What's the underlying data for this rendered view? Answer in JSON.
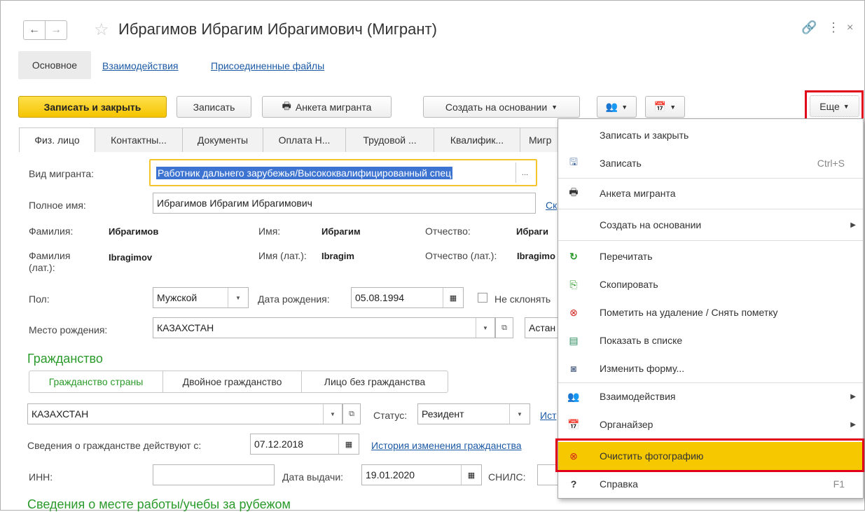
{
  "window": {
    "title": "Ибрагимов Ибрагим Ибрагимович (Мигрант)"
  },
  "nav_tabs": [
    "Основное",
    "Взаимодействия",
    "Присоединенные файлы"
  ],
  "toolbar": {
    "save_close": "Записать и закрыть",
    "save": "Записать",
    "anketa": "Анкета мигранта",
    "create_basis": "Создать на основании",
    "more": "Еще"
  },
  "tabs": [
    "Физ. лицо",
    "Контактны...",
    "Документы",
    "Оплата Н...",
    "Трудовой ...",
    "Квалифик...",
    "Мигр"
  ],
  "form": {
    "vid_label": "Вид мигранта:",
    "vid_value": "Работник дальнего зарубежья/Высококвалифицированный спец",
    "fullname_label": "Полное имя:",
    "fullname_value": "Ибрагимов Ибрагим Ибрагимович",
    "fullname_link": "Ск",
    "surname_label": "Фамилия:",
    "surname_value": "Ибрагимов",
    "name_label": "Имя:",
    "name_value": "Ибрагим",
    "patr_label": "Отчество:",
    "patr_value": "Ибраги",
    "surname_lat_label_1": "Фамилия",
    "surname_lat_label_2": "(лат.):",
    "surname_lat_value": "Ibragimov",
    "name_lat_label": "Имя (лат.):",
    "name_lat_value": "Ibragim",
    "patr_lat_label": "Отчество (лат.):",
    "patr_lat_value": "Ibragimo",
    "sex_label": "Пол:",
    "sex_value": "Мужской",
    "dob_label": "Дата рождения:",
    "dob_value": "05.08.1994",
    "no_decline_label": "Не склонять",
    "birthplace_label": "Место рождения:",
    "birthplace_value": "КАЗАХСТАН",
    "birthplace_city": "Астан"
  },
  "citizenship": {
    "header": "Гражданство",
    "segments": [
      "Гражданство страны",
      "Двойное гражданство",
      "Лицо без гражданства"
    ],
    "country": "КАЗАХСТАН",
    "status_label": "Статус:",
    "status_value": "Резидент",
    "history_link_short": "Ист",
    "since_label": "Сведения о гражданстве действуют с:",
    "since_value": "07.12.2018",
    "history_link": "История изменения гражданства"
  },
  "ids": {
    "inn_label": "ИНН:",
    "inn_value": "",
    "issue_label": "Дата выдачи:",
    "issue_value": "19.01.2020",
    "snils_label": "СНИЛС:"
  },
  "work_abroad_header": "Сведения о месте работы/учебы за рубежом",
  "menu": {
    "items": [
      {
        "label": "Записать и закрыть",
        "shortcut": "",
        "icon": ""
      },
      {
        "label": "Записать",
        "shortcut": "Ctrl+S",
        "icon": "save-icon"
      },
      {
        "label": "Анкета мигранта",
        "shortcut": "",
        "icon": "printer-icon"
      },
      {
        "label": "Создать на основании",
        "shortcut": "",
        "icon": ""
      },
      {
        "label": "Перечитать",
        "shortcut": "",
        "icon": "refresh-icon"
      },
      {
        "label": "Скопировать",
        "shortcut": "",
        "icon": "copy-icon"
      },
      {
        "label": "Пометить на удаление / Снять пометку",
        "shortcut": "",
        "icon": "delete-mark-icon"
      },
      {
        "label": "Показать в списке",
        "shortcut": "",
        "icon": "list-icon"
      },
      {
        "label": "Изменить форму...",
        "shortcut": "",
        "icon": "form-settings-icon"
      },
      {
        "label": "Взаимодействия",
        "shortcut": "",
        "icon": "interactions-icon"
      },
      {
        "label": "Органайзер",
        "shortcut": "",
        "icon": "organizer-icon"
      },
      {
        "label": "Очистить фотографию",
        "shortcut": "",
        "icon": "clear-photo-icon"
      },
      {
        "label": "Справка",
        "shortcut": "F1",
        "icon": "help-icon"
      }
    ]
  },
  "colors": {
    "accent_yellow": "#f6c800",
    "highlight_red": "#e0001a",
    "section_green": "#2a9a2a",
    "link_blue": "#1c5aa6"
  }
}
